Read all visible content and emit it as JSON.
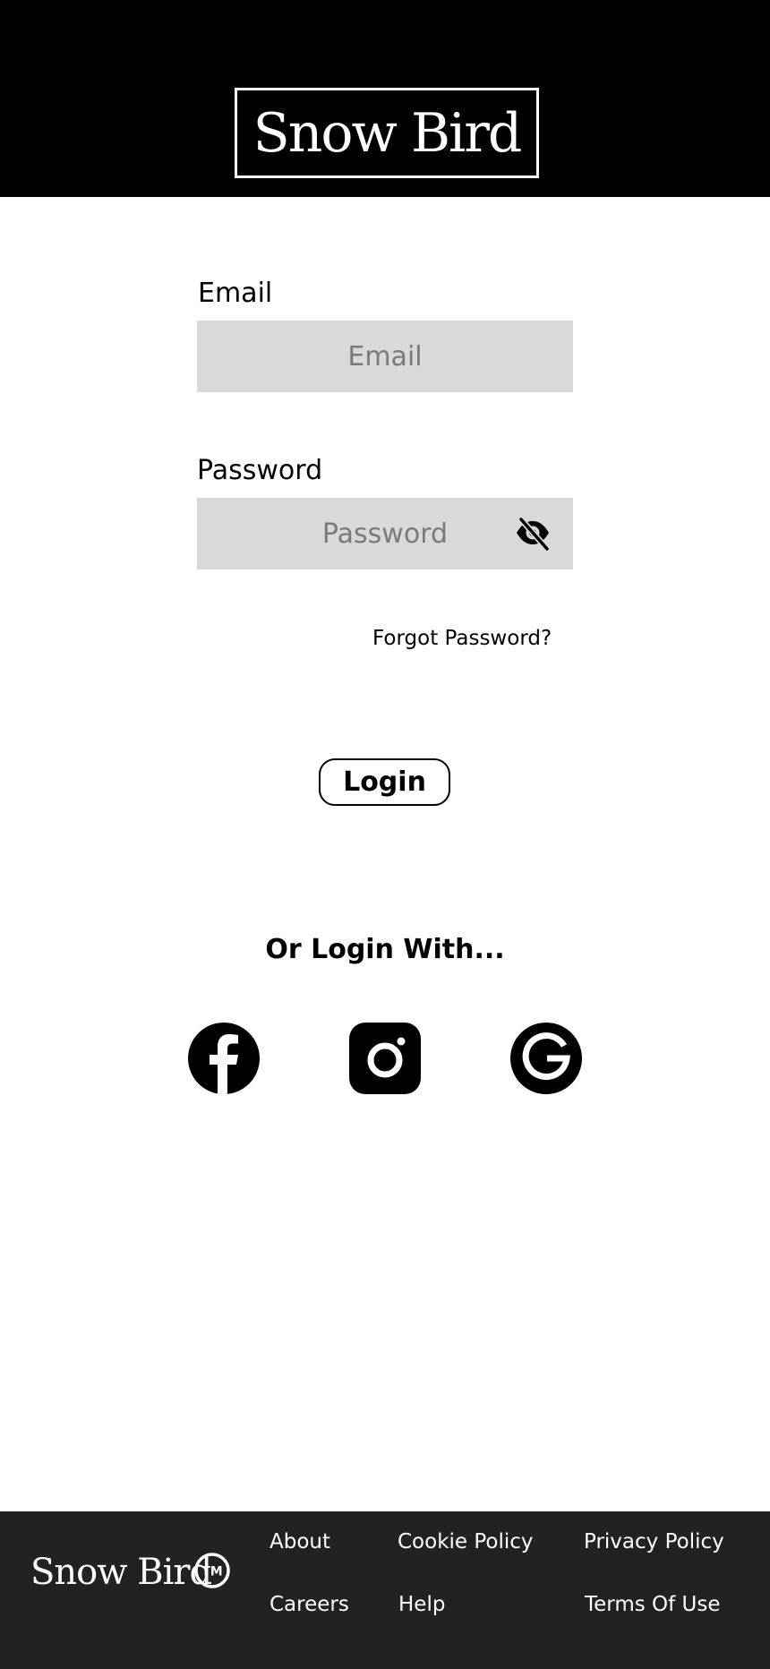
{
  "header": {
    "logo_text": "Snow Bird"
  },
  "form": {
    "email_label": "Email",
    "email_placeholder": "Email",
    "email_value": "",
    "password_label": "Password",
    "password_placeholder": "Password",
    "password_value": "",
    "password_visibility_icon": "eye-off-icon",
    "forgot_password": "Forgot Password?",
    "login_button": "Login"
  },
  "social": {
    "heading": "Or Login With...",
    "providers": [
      {
        "icon": "facebook-icon"
      },
      {
        "icon": "instagram-icon"
      },
      {
        "icon": "google-icon"
      }
    ]
  },
  "footer": {
    "logo_text": "Snow Bird",
    "trademark": "TM",
    "links": {
      "about": "About",
      "careers": "Careers",
      "cookie_policy": "Cookie Policy",
      "help": "Help",
      "privacy_policy": "Privacy Policy",
      "terms_of_use": "Terms Of Use"
    }
  },
  "colors": {
    "header_bg": "#000000",
    "input_bg": "#d9d9d9",
    "footer_bg": "#222222",
    "text": "#000000"
  }
}
